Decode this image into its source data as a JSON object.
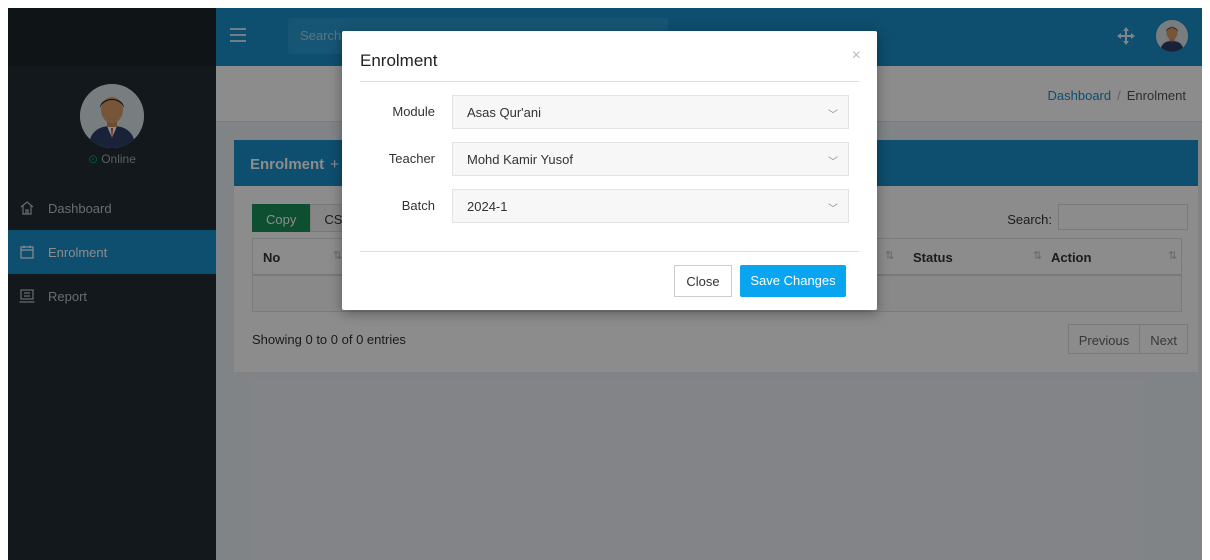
{
  "header": {
    "search_placeholder": "Search..."
  },
  "sidebar": {
    "status": "Online",
    "items": [
      {
        "label": "Dashboard",
        "icon": "home-icon"
      },
      {
        "label": "Enrolment",
        "icon": "calendar-icon",
        "active": true
      },
      {
        "label": "Report",
        "icon": "report-icon"
      }
    ]
  },
  "breadcrumb": {
    "home": "Dashboard",
    "current": "Enrolment"
  },
  "box": {
    "title": "Enrolment",
    "add_icon": "+",
    "buttons": {
      "copy": "Copy",
      "csv": "CSV"
    },
    "search_label": "Search:",
    "columns": [
      "No",
      "Status",
      "Action"
    ],
    "info": "Showing 0 to 0 of 0 entries",
    "pager": {
      "previous": "Previous",
      "next": "Next"
    }
  },
  "modal": {
    "title": "Enrolment",
    "close_glyph": "×",
    "fields": [
      {
        "label": "Module",
        "value": "Asas Qur'ani"
      },
      {
        "label": "Teacher",
        "value": "Mohd Kamir Yusof"
      },
      {
        "label": "Batch",
        "value": "2024-1"
      }
    ],
    "close_label": "Close",
    "save_label": "Save Changes"
  },
  "colors": {
    "primary": "#1a8fc9",
    "sidebar": "#222d32",
    "success": "#1b8e5a",
    "save": "#0aa5f0",
    "online": "#00a65a"
  }
}
